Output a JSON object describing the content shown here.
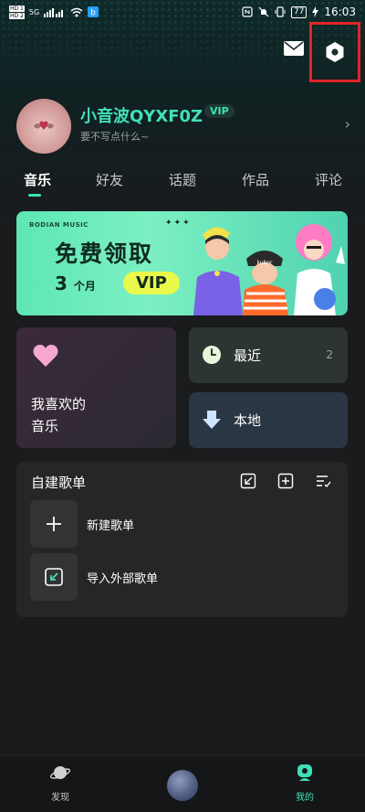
{
  "status_bar": {
    "sim1": "HD 1",
    "sim2": "HD 2",
    "signal": "5G",
    "battery": "77",
    "time": "16:03"
  },
  "header": {
    "mail_icon": "envelope-icon",
    "settings_icon": "hexagon-settings-icon",
    "highlight_color": "#e0242a"
  },
  "profile": {
    "username": "小音波QYXF0Z",
    "vip_badge": "VIP",
    "bio": "要不写点什么~"
  },
  "tabs": [
    {
      "label": "音乐",
      "active": true
    },
    {
      "label": "好友",
      "active": false
    },
    {
      "label": "话题",
      "active": false
    },
    {
      "label": "作品",
      "active": false
    },
    {
      "label": "评论",
      "active": false
    }
  ],
  "banner": {
    "brand": "BODIAN MUSIC",
    "title": "免费领取",
    "months_num": "3",
    "months_unit": "个月",
    "vip": "VIP"
  },
  "cards": {
    "favorites": "我喜欢的\n音乐",
    "recent": {
      "label": "最近",
      "count": "2"
    },
    "local": {
      "label": "本地"
    }
  },
  "playlists": {
    "title": "自建歌单",
    "items": [
      {
        "label": "新建歌单",
        "icon": "plus-icon"
      },
      {
        "label": "导入外部歌单",
        "icon": "import-icon"
      }
    ]
  },
  "bottom_nav": {
    "items": [
      {
        "label": "发现",
        "icon": "planet-icon",
        "active": false
      },
      {
        "label": "我的",
        "icon": "profile-icon",
        "active": true
      }
    ]
  },
  "colors": {
    "accent": "#3fe0b8",
    "background": "#1a1b1d"
  }
}
